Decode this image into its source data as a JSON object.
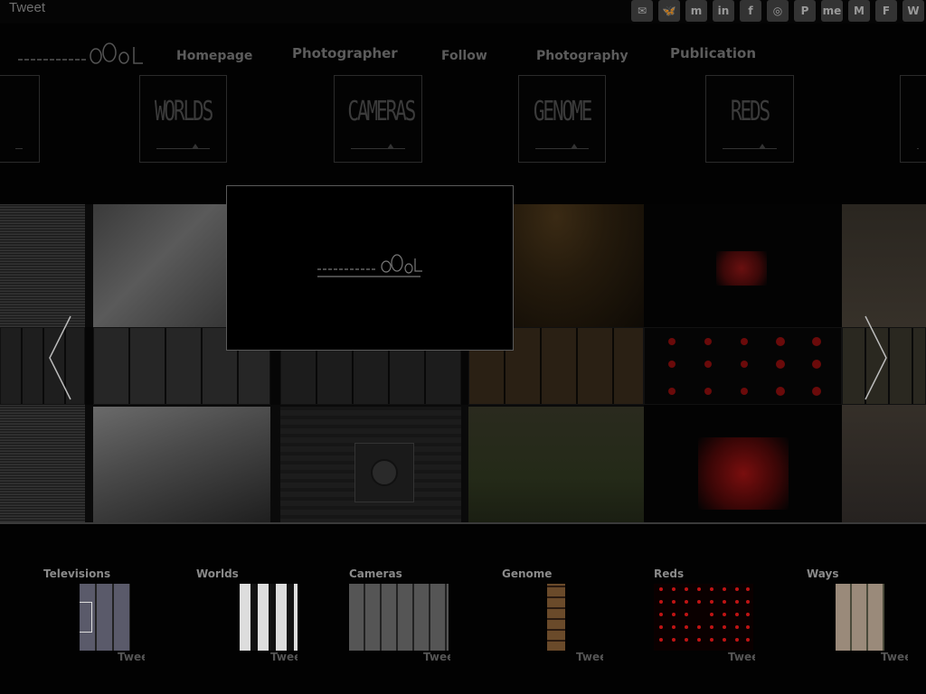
{
  "top": {
    "tweet_label": "Tweet",
    "social_icons": [
      {
        "name": "mail-icon",
        "glyph": "✉"
      },
      {
        "name": "bluesky-icon",
        "glyph": "🦋"
      },
      {
        "name": "mastodon-icon",
        "glyph": "m"
      },
      {
        "name": "linkedin-icon",
        "glyph": "in"
      },
      {
        "name": "facebook-icon",
        "glyph": "f"
      },
      {
        "name": "instagram-icon",
        "glyph": "◎"
      },
      {
        "name": "pinterest-icon",
        "glyph": "P"
      },
      {
        "name": "about-me-icon",
        "glyph": "me"
      },
      {
        "name": "medium-icon",
        "glyph": "M"
      },
      {
        "name": "flipboard-icon",
        "glyph": "F"
      },
      {
        "name": "wordpress-icon",
        "glyph": "W"
      }
    ]
  },
  "nav": {
    "homepage": "Homepage",
    "photographer": "Photographer",
    "follow": "Follow",
    "photography": "Photography",
    "publication": "Publication"
  },
  "banners": [
    "WORLDS",
    "CAMERAS",
    "GENOME",
    "REDS"
  ],
  "series": [
    {
      "title": "Televisions",
      "tweet": "Tweet"
    },
    {
      "title": "Worlds",
      "tweet": "Tweet"
    },
    {
      "title": "Cameras",
      "tweet": "Tweet"
    },
    {
      "title": "Genome",
      "tweet": "Tweet"
    },
    {
      "title": "Reds",
      "tweet": "Tweet"
    },
    {
      "title": "Ways",
      "tweet": "Tweet"
    }
  ],
  "colors": {
    "background": "#020202",
    "nav_text": "#5c5c5c",
    "series_title": "#8a8a8a",
    "reds_accent": "#c01414"
  }
}
